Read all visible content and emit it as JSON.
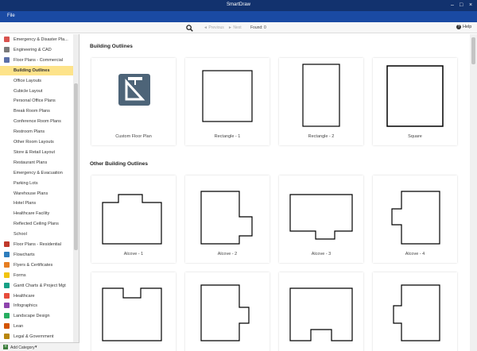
{
  "window": {
    "title": "SmartDraw"
  },
  "menubar": {
    "file": "File"
  },
  "toolbar": {
    "previous": "◄ Previous",
    "next": "► Next",
    "found": "Found: 0",
    "help": "Help"
  },
  "sidebar": {
    "items": [
      {
        "label": "Emergency & Disaster Pla...",
        "icon_color": "#d9534f",
        "type": "category"
      },
      {
        "label": "Engineering & CAD",
        "icon_color": "#7a7a7a",
        "type": "category"
      },
      {
        "label": "Floor Plans - Commercial",
        "icon_color": "#5b6fa8",
        "type": "category"
      },
      {
        "label": "Building Outlines",
        "type": "sub",
        "active": true
      },
      {
        "label": "Office Layouts",
        "type": "sub"
      },
      {
        "label": "Cubicle Layout",
        "type": "sub"
      },
      {
        "label": "Personal Office Plans",
        "type": "sub"
      },
      {
        "label": "Break Room Plans",
        "type": "sub"
      },
      {
        "label": "Conference Room Plans",
        "type": "sub"
      },
      {
        "label": "Restroom Plans",
        "type": "sub"
      },
      {
        "label": "Other Room Layouts",
        "type": "sub"
      },
      {
        "label": "Store & Retail Layout",
        "type": "sub"
      },
      {
        "label": "Restaurant Plans",
        "type": "sub"
      },
      {
        "label": "Emergency & Evacuation",
        "type": "sub"
      },
      {
        "label": "Parking Lots",
        "type": "sub"
      },
      {
        "label": "Warehouse Plans",
        "type": "sub"
      },
      {
        "label": "Hotel Plans",
        "type": "sub"
      },
      {
        "label": "Healthcare Facility",
        "type": "sub"
      },
      {
        "label": "Reflected Ceiling Plans",
        "type": "sub"
      },
      {
        "label": "School",
        "type": "sub"
      },
      {
        "label": "Floor Plans - Residential",
        "icon_color": "#c0392b",
        "type": "category"
      },
      {
        "label": "Flowcharts",
        "icon_color": "#2e7dbd",
        "type": "category"
      },
      {
        "label": "Flyers & Certificates",
        "icon_color": "#e67e22",
        "type": "category"
      },
      {
        "label": "Forms",
        "icon_color": "#f1c40f",
        "type": "category"
      },
      {
        "label": "Gantt Charts & Project Mgt",
        "icon_color": "#16a085",
        "type": "category"
      },
      {
        "label": "Healthcare",
        "icon_color": "#e74c3c",
        "type": "category"
      },
      {
        "label": "Infographics",
        "icon_color": "#8e44ad",
        "type": "category"
      },
      {
        "label": "Landscape Design",
        "icon_color": "#27ae60",
        "type": "category"
      },
      {
        "label": "Lean",
        "icon_color": "#d35400",
        "type": "category"
      },
      {
        "label": "Legal & Government",
        "icon_color": "#b8860b",
        "type": "category"
      }
    ],
    "add_category": "Add Category"
  },
  "main": {
    "section1_title": "Building Outlines",
    "section2_title": "Other Building Outlines",
    "row1": [
      {
        "label": "Custom Floor Plan",
        "shape": "custom"
      },
      {
        "label": "Rectangle - 1",
        "shape": "rect1"
      },
      {
        "label": "Rectangle - 2",
        "shape": "rect2"
      },
      {
        "label": "Square",
        "shape": "square"
      }
    ],
    "row2": [
      {
        "label": "Alcove - 1",
        "shape": "alcove1"
      },
      {
        "label": "Alcove - 2",
        "shape": "alcove2"
      },
      {
        "label": "Alcove - 3",
        "shape": "alcove3"
      },
      {
        "label": "Alcove - 4",
        "shape": "alcove4"
      }
    ],
    "row3": [
      {
        "label": "",
        "shape": "alcove5"
      },
      {
        "label": "",
        "shape": "alcove6"
      },
      {
        "label": "",
        "shape": "alcove7"
      },
      {
        "label": "",
        "shape": "alcove8"
      }
    ]
  }
}
